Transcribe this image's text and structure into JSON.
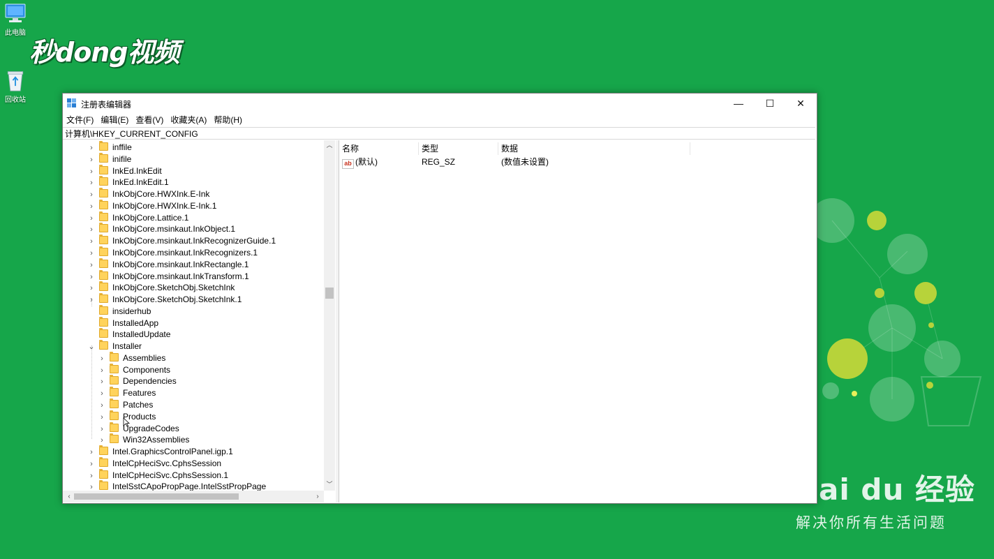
{
  "desktop": {
    "icons": [
      {
        "label": "此电脑",
        "icon": "computer-icon"
      },
      {
        "label": "回收站",
        "icon": "recycle-bin-icon"
      }
    ]
  },
  "watermark": {
    "top_left": "秒dong视频",
    "brand": "Bai du 经验",
    "slogan": "解决你所有生活问题"
  },
  "window": {
    "title": "注册表编辑器",
    "controls": {
      "minimize": "—",
      "maximize": "☐",
      "close": "✕"
    },
    "menu": [
      "文件(F)",
      "编辑(E)",
      "查看(V)",
      "收藏夹(A)",
      "帮助(H)"
    ],
    "address": "计算机\\HKEY_CURRENT_CONFIG",
    "tree": [
      {
        "label": "inffile",
        "depth": 0,
        "state": "collapsed"
      },
      {
        "label": "inifile",
        "depth": 0,
        "state": "collapsed"
      },
      {
        "label": "InkEd.InkEdit",
        "depth": 0,
        "state": "collapsed"
      },
      {
        "label": "InkEd.InkEdit.1",
        "depth": 0,
        "state": "collapsed"
      },
      {
        "label": "InkObjCore.HWXInk.E-Ink",
        "depth": 0,
        "state": "collapsed"
      },
      {
        "label": "InkObjCore.HWXInk.E-Ink.1",
        "depth": 0,
        "state": "collapsed"
      },
      {
        "label": "InkObjCore.Lattice.1",
        "depth": 0,
        "state": "collapsed"
      },
      {
        "label": "InkObjCore.msinkaut.InkObject.1",
        "depth": 0,
        "state": "collapsed"
      },
      {
        "label": "InkObjCore.msinkaut.InkRecognizerGuide.1",
        "depth": 0,
        "state": "collapsed"
      },
      {
        "label": "InkObjCore.msinkaut.InkRecognizers.1",
        "depth": 0,
        "state": "collapsed"
      },
      {
        "label": "InkObjCore.msinkaut.InkRectangle.1",
        "depth": 0,
        "state": "collapsed"
      },
      {
        "label": "InkObjCore.msinkaut.InkTransform.1",
        "depth": 0,
        "state": "collapsed"
      },
      {
        "label": "InkObjCore.SketchObj.SketchInk",
        "depth": 0,
        "state": "collapsed"
      },
      {
        "label": "InkObjCore.SketchObj.SketchInk.1",
        "depth": 0,
        "state": "collapsed"
      },
      {
        "label": "insiderhub",
        "depth": 0,
        "state": "leaf"
      },
      {
        "label": "InstalledApp",
        "depth": 0,
        "state": "leaf"
      },
      {
        "label": "InstalledUpdate",
        "depth": 0,
        "state": "leaf"
      },
      {
        "label": "Installer",
        "depth": 0,
        "state": "expanded"
      },
      {
        "label": "Assemblies",
        "depth": 1,
        "state": "collapsed"
      },
      {
        "label": "Components",
        "depth": 1,
        "state": "collapsed"
      },
      {
        "label": "Dependencies",
        "depth": 1,
        "state": "collapsed"
      },
      {
        "label": "Features",
        "depth": 1,
        "state": "collapsed"
      },
      {
        "label": "Patches",
        "depth": 1,
        "state": "collapsed"
      },
      {
        "label": "Products",
        "depth": 1,
        "state": "collapsed"
      },
      {
        "label": "UpgradeCodes",
        "depth": 1,
        "state": "collapsed"
      },
      {
        "label": "Win32Assemblies",
        "depth": 1,
        "state": "collapsed"
      },
      {
        "label": "Intel.GraphicsControlPanel.igp.1",
        "depth": 0,
        "state": "collapsed"
      },
      {
        "label": "IntelCpHeciSvc.CphsSession",
        "depth": 0,
        "state": "collapsed"
      },
      {
        "label": "IntelCpHeciSvc.CphsSession.1",
        "depth": 0,
        "state": "collapsed"
      },
      {
        "label": "IntelSstCApoPropPage.IntelSstPropPage",
        "depth": 0,
        "state": "collapsed"
      }
    ],
    "columns": [
      "名称",
      "类型",
      "数据"
    ],
    "values": [
      {
        "name": "(默认)",
        "type": "REG_SZ",
        "data": "(数值未设置)",
        "icon": "ab-string-icon"
      }
    ],
    "colors": {
      "desktop": "#16a64a",
      "folder": "#ffd35c"
    }
  }
}
